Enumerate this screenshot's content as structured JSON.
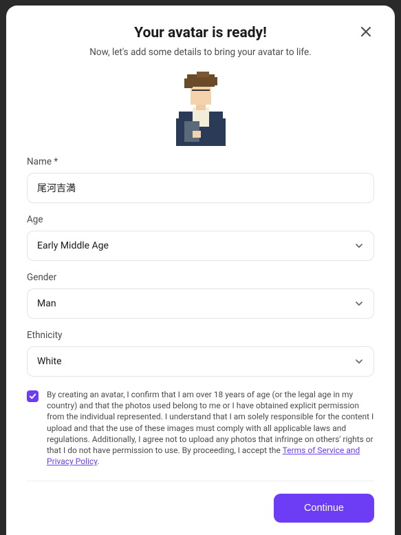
{
  "header": {
    "title": "Your avatar is ready!",
    "subtitle": "Now, let's add some details to bring your avatar to life."
  },
  "fields": {
    "name": {
      "label": "Name *",
      "value": "尾河吉満"
    },
    "age": {
      "label": "Age",
      "value": "Early Middle Age"
    },
    "gender": {
      "label": "Gender",
      "value": "Man"
    },
    "ethnicity": {
      "label": "Ethnicity",
      "value": "White"
    }
  },
  "consent": {
    "text_before_link": "By creating an avatar, I confirm that I am over 18 years of age (or the legal age in my country) and that the photos used belong to me or I have obtained explicit permission from the individual represented. I understand that I am solely responsible for the content I upload and that the use of these images must comply with all applicable laws and regulations. Additionally, I agree not to upload any photos that infringe on others' rights or that I do not have permission to use. By proceeding, I accept the ",
    "link_text": "Terms of Service and Privacy Policy",
    "text_after_link": "."
  },
  "footer": {
    "continue_label": "Continue"
  }
}
